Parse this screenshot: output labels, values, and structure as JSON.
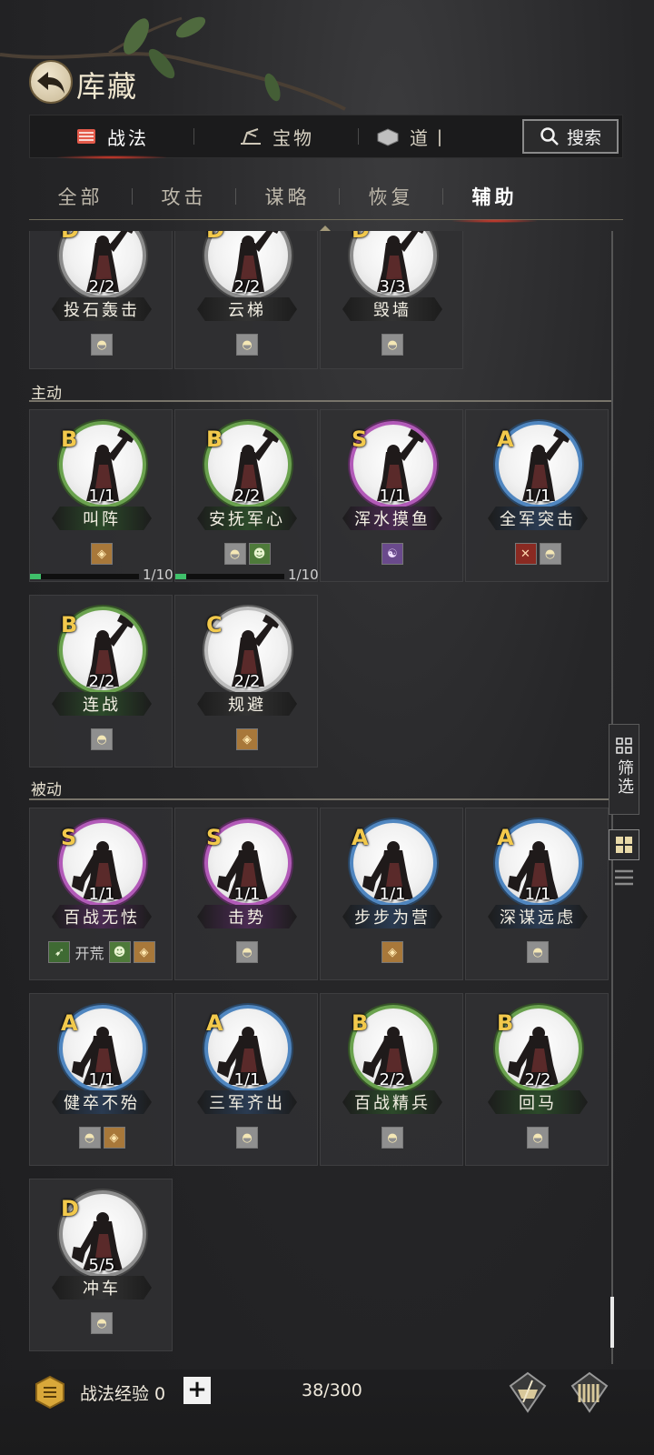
{
  "header": {
    "title": "库藏",
    "back_icon": "back-arrow-icon"
  },
  "main_tabs": [
    {
      "label": "战法",
      "icon": "scroll-icon",
      "active": true
    },
    {
      "label": "宝物",
      "icon": "treasure-icon",
      "active": false
    },
    {
      "label": "道⼁",
      "icon": "item-icon",
      "active": false
    }
  ],
  "search": {
    "label": "搜索",
    "icon": "search-icon"
  },
  "sub_tabs": [
    {
      "label": "全部",
      "active": false
    },
    {
      "label": "攻击",
      "active": false
    },
    {
      "label": "谋略",
      "active": false
    },
    {
      "label": "恢复",
      "active": false
    },
    {
      "label": "辅助",
      "active": true
    }
  ],
  "sections": {
    "active": "主动",
    "passive": "被动"
  },
  "top_partial": [
    {
      "name": "投石轰击",
      "level": "2/2",
      "rank": "D",
      "tags": [
        "bag"
      ]
    },
    {
      "name": "云梯",
      "level": "2/2",
      "rank": "D",
      "tags": [
        "bag"
      ]
    },
    {
      "name": "毁墙",
      "level": "3/3",
      "rank": "D",
      "tags": [
        "bag"
      ]
    }
  ],
  "active_cards": [
    {
      "name": "叫阵",
      "level": "1/1",
      "rank": "B",
      "tags": [
        "shield"
      ],
      "progress": "1/10",
      "progress_fraction": 0.1
    },
    {
      "name": "安抚军心",
      "level": "2/2",
      "rank": "B",
      "tags": [
        "bag",
        "troop"
      ],
      "progress": "1/10",
      "progress_fraction": 0.1
    },
    {
      "name": "浑水摸鱼",
      "level": "1/1",
      "rank": "S",
      "tags": [
        "face"
      ]
    },
    {
      "name": "全军突击",
      "level": "1/1",
      "rank": "A",
      "tags": [
        "sword",
        "bag"
      ]
    },
    {
      "name": "连战",
      "level": "2/2",
      "rank": "B",
      "tags": [
        "bag"
      ]
    },
    {
      "name": "规避",
      "level": "2/2",
      "rank": "C",
      "tags": [
        "shield"
      ]
    }
  ],
  "passive_cards": [
    {
      "name": "百战无怯",
      "level": "1/1",
      "rank": "S",
      "tags": [
        "green",
        "text:开荒",
        "troop",
        "shield"
      ]
    },
    {
      "name": "击势",
      "level": "1/1",
      "rank": "S",
      "tags": [
        "bag"
      ]
    },
    {
      "name": "步步为营",
      "level": "1/1",
      "rank": "A",
      "tags": [
        "shield"
      ]
    },
    {
      "name": "深谋远虑",
      "level": "1/1",
      "rank": "A",
      "tags": [
        "bag"
      ]
    },
    {
      "name": "健卒不殆",
      "level": "1/1",
      "rank": "A",
      "tags": [
        "bag",
        "shield"
      ]
    },
    {
      "name": "三军齐出",
      "level": "1/1",
      "rank": "A",
      "tags": [
        "bag"
      ]
    },
    {
      "name": "百战精兵",
      "level": "2/2",
      "rank": "B",
      "tags": [
        "bag"
      ]
    },
    {
      "name": "回马",
      "level": "2/2",
      "rank": "B",
      "tags": [
        "bag"
      ]
    },
    {
      "name": "冲车",
      "level": "5/5",
      "rank": "D",
      "tags": [
        "bag"
      ]
    }
  ],
  "filter": {
    "label": "筛选",
    "icon": "grid-icon"
  },
  "view_toggles": {
    "grid_icon": "grid-view-icon",
    "list_icon": "list-view-icon"
  },
  "bottom": {
    "exp_label": "战法经验 0",
    "plus": "+",
    "count": "38/300",
    "icons": [
      "book-sword-icon",
      "scroll-stack-icon"
    ]
  },
  "colors": {
    "rank_S": "#b25ab8",
    "rank_A": "#4f86c0",
    "rank_B": "#6aa24e",
    "rank_C": "#bdbdbd",
    "rank_D": "#8c8c8c",
    "active_tab_glow": "#e03a2a",
    "rank_letter": "#f2c94c"
  }
}
